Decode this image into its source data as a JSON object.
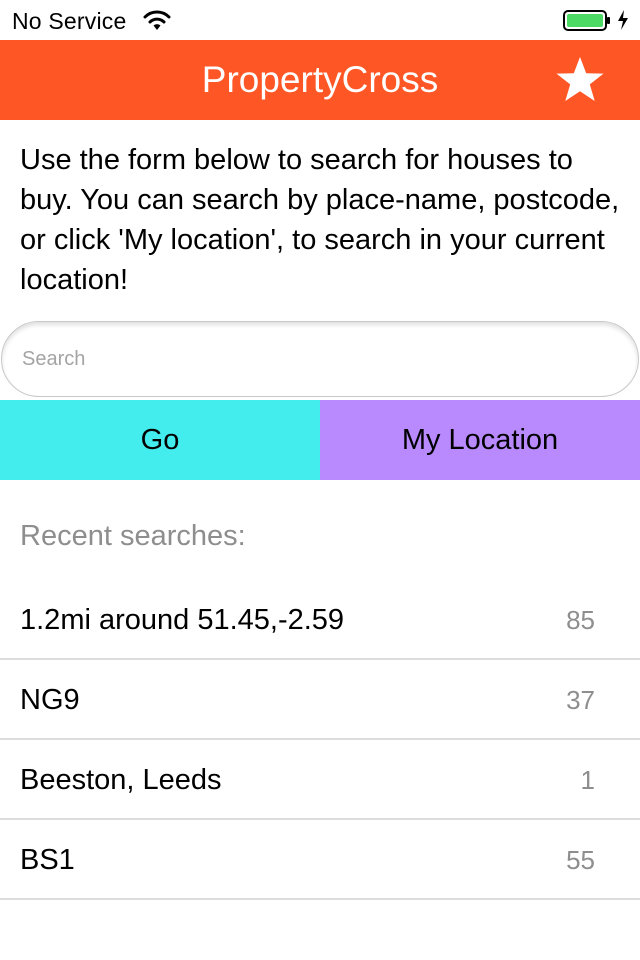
{
  "status_bar": {
    "carrier": "No Service",
    "wifi_icon": "wifi-icon",
    "battery_icon": "battery-icon",
    "battery_level": 1.0,
    "battery_color": "#4cd964",
    "charging_icon": "bolt-icon"
  },
  "nav": {
    "title": "PropertyCross",
    "favourites_icon": "star-icon",
    "background": "#ff5626"
  },
  "intro": {
    "text": "Use the form below to search for houses to buy. You can search by place-name, postcode, or click 'My location', to search in your current location!"
  },
  "search": {
    "placeholder": "Search",
    "value": ""
  },
  "buttons": {
    "go_label": "Go",
    "go_color": "#43eced",
    "location_label": "My Location",
    "location_color": "#b98afd"
  },
  "recent": {
    "header": "Recent searches:",
    "items": [
      {
        "place": "1.2mi around 51.45,-2.59",
        "count": "85"
      },
      {
        "place": "NG9",
        "count": "37"
      },
      {
        "place": "Beeston, Leeds",
        "count": "1"
      },
      {
        "place": "BS1",
        "count": "55"
      }
    ]
  }
}
